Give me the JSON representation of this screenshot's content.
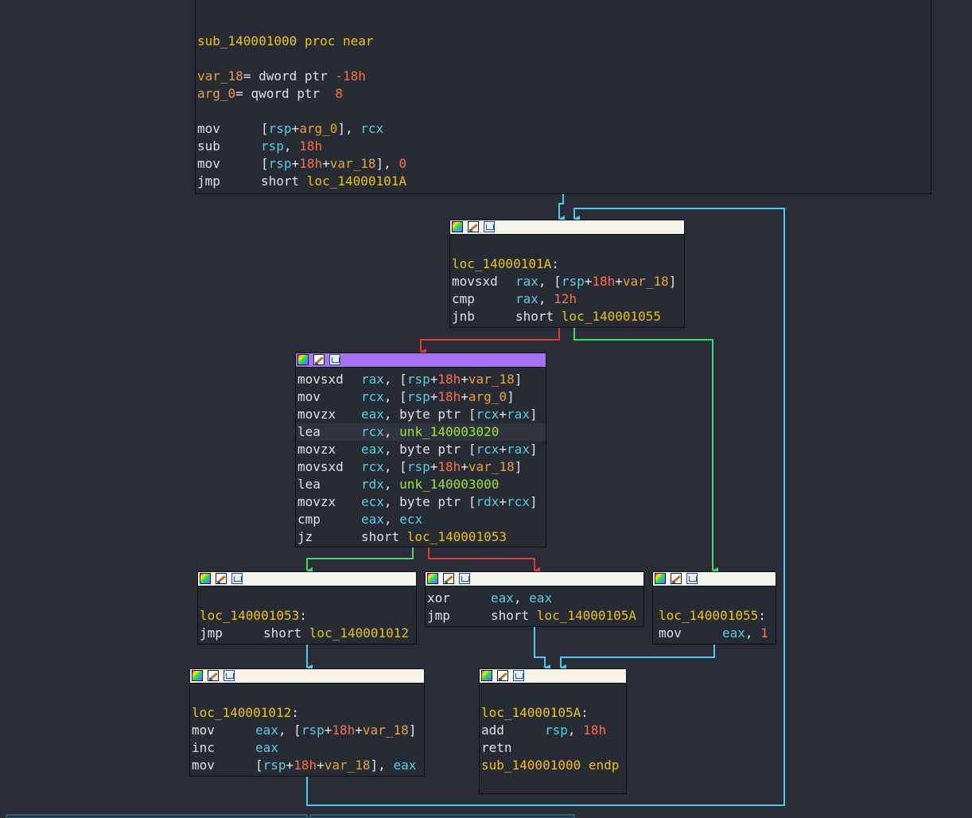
{
  "blocks": {
    "entry": {
      "proc_decl": "sub_140001000 proc near",
      "var_18": {
        "name": "var_18",
        "eq": "= dword ptr ",
        "val": "-18h"
      },
      "arg_0": {
        "name": "arg_0",
        "eq": "= qword ptr  ",
        "val": "8"
      },
      "instructions": [
        {
          "mnemonic": "mov",
          "ops": [
            {
              "t": "p",
              "v": "["
            },
            {
              "t": "r",
              "v": "rsp"
            },
            {
              "t": "p",
              "v": "+"
            },
            {
              "t": "v",
              "v": "arg_0"
            },
            {
              "t": "p",
              "v": "], "
            },
            {
              "t": "r",
              "v": "rcx"
            }
          ]
        },
        {
          "mnemonic": "sub",
          "ops": [
            {
              "t": "r",
              "v": "rsp"
            },
            {
              "t": "p",
              "v": ", "
            },
            {
              "t": "n",
              "v": "18h"
            }
          ]
        },
        {
          "mnemonic": "mov",
          "ops": [
            {
              "t": "p",
              "v": "["
            },
            {
              "t": "r",
              "v": "rsp"
            },
            {
              "t": "p",
              "v": "+"
            },
            {
              "t": "n",
              "v": "18h"
            },
            {
              "t": "p",
              "v": "+"
            },
            {
              "t": "v",
              "v": "var_18"
            },
            {
              "t": "p",
              "v": "], "
            },
            {
              "t": "n",
              "v": "0"
            }
          ]
        },
        {
          "mnemonic": "jmp",
          "ops": [
            {
              "t": "w",
              "v": "short "
            },
            {
              "t": "loc",
              "v": "loc_14000101A"
            }
          ]
        }
      ]
    },
    "loop_head": {
      "label": "loc_14000101A",
      "instructions": [
        {
          "mnemonic": "movsxd",
          "ops": [
            {
              "t": "r",
              "v": "rax"
            },
            {
              "t": "p",
              "v": ", ["
            },
            {
              "t": "r",
              "v": "rsp"
            },
            {
              "t": "p",
              "v": "+"
            },
            {
              "t": "n",
              "v": "18h"
            },
            {
              "t": "p",
              "v": "+"
            },
            {
              "t": "v",
              "v": "var_18"
            },
            {
              "t": "p",
              "v": "]"
            }
          ]
        },
        {
          "mnemonic": "cmp",
          "ops": [
            {
              "t": "r",
              "v": "rax"
            },
            {
              "t": "p",
              "v": ", "
            },
            {
              "t": "n",
              "v": "12h"
            }
          ]
        },
        {
          "mnemonic": "jnb",
          "ops": [
            {
              "t": "w",
              "v": "short "
            },
            {
              "t": "loc",
              "v": "loc_140001055"
            }
          ]
        }
      ]
    },
    "compare": {
      "instructions": [
        {
          "mnemonic": "movsxd",
          "ops": [
            {
              "t": "r",
              "v": "rax"
            },
            {
              "t": "p",
              "v": ", ["
            },
            {
              "t": "r",
              "v": "rsp"
            },
            {
              "t": "p",
              "v": "+"
            },
            {
              "t": "n",
              "v": "18h"
            },
            {
              "t": "p",
              "v": "+"
            },
            {
              "t": "v",
              "v": "var_18"
            },
            {
              "t": "p",
              "v": "]"
            }
          ]
        },
        {
          "mnemonic": "mov",
          "ops": [
            {
              "t": "r",
              "v": "rcx"
            },
            {
              "t": "p",
              "v": ", ["
            },
            {
              "t": "r",
              "v": "rsp"
            },
            {
              "t": "p",
              "v": "+"
            },
            {
              "t": "n",
              "v": "18h"
            },
            {
              "t": "p",
              "v": "+"
            },
            {
              "t": "v",
              "v": "arg_0"
            },
            {
              "t": "p",
              "v": "]"
            }
          ]
        },
        {
          "mnemonic": "movzx",
          "ops": [
            {
              "t": "r",
              "v": "eax"
            },
            {
              "t": "p",
              "v": ", byte ptr ["
            },
            {
              "t": "r",
              "v": "rcx"
            },
            {
              "t": "p",
              "v": "+"
            },
            {
              "t": "r",
              "v": "rax"
            },
            {
              "t": "p",
              "v": "]"
            }
          ]
        },
        {
          "mnemonic": "lea",
          "ops": [
            {
              "t": "r",
              "v": "rcx"
            },
            {
              "t": "p",
              "v": ", "
            },
            {
              "t": "unk",
              "v": "unk_140003020"
            }
          ],
          "highlight": true
        },
        {
          "mnemonic": "movzx",
          "ops": [
            {
              "t": "r",
              "v": "eax"
            },
            {
              "t": "p",
              "v": ", byte ptr ["
            },
            {
              "t": "r",
              "v": "rcx"
            },
            {
              "t": "p",
              "v": "+"
            },
            {
              "t": "r",
              "v": "rax"
            },
            {
              "t": "p",
              "v": "]"
            }
          ]
        },
        {
          "mnemonic": "movsxd",
          "ops": [
            {
              "t": "r",
              "v": "rcx"
            },
            {
              "t": "p",
              "v": ", ["
            },
            {
              "t": "r",
              "v": "rsp"
            },
            {
              "t": "p",
              "v": "+"
            },
            {
              "t": "n",
              "v": "18h"
            },
            {
              "t": "p",
              "v": "+"
            },
            {
              "t": "v",
              "v": "var_18"
            },
            {
              "t": "p",
              "v": "]"
            }
          ]
        },
        {
          "mnemonic": "lea",
          "ops": [
            {
              "t": "r",
              "v": "rdx"
            },
            {
              "t": "p",
              "v": ", "
            },
            {
              "t": "unk",
              "v": "unk_140003000"
            }
          ]
        },
        {
          "mnemonic": "movzx",
          "ops": [
            {
              "t": "r",
              "v": "ecx"
            },
            {
              "t": "p",
              "v": ", byte ptr ["
            },
            {
              "t": "r",
              "v": "rdx"
            },
            {
              "t": "p",
              "v": "+"
            },
            {
              "t": "r",
              "v": "rcx"
            },
            {
              "t": "p",
              "v": "]"
            }
          ]
        },
        {
          "mnemonic": "cmp",
          "ops": [
            {
              "t": "r",
              "v": "eax"
            },
            {
              "t": "p",
              "v": ", "
            },
            {
              "t": "r",
              "v": "ecx"
            }
          ]
        },
        {
          "mnemonic": "jz",
          "ops": [
            {
              "t": "w",
              "v": "short "
            },
            {
              "t": "loc",
              "v": "loc_140001053"
            }
          ]
        }
      ]
    },
    "match": {
      "label": "loc_140001053",
      "instructions": [
        {
          "mnemonic": "jmp",
          "ops": [
            {
              "t": "w",
              "v": "short "
            },
            {
              "t": "loc",
              "v": "loc_140001012"
            }
          ]
        }
      ]
    },
    "mismatch": {
      "instructions": [
        {
          "mnemonic": "xor",
          "ops": [
            {
              "t": "r",
              "v": "eax"
            },
            {
              "t": "p",
              "v": ", "
            },
            {
              "t": "r",
              "v": "eax"
            }
          ]
        },
        {
          "mnemonic": "jmp",
          "ops": [
            {
              "t": "w",
              "v": "short "
            },
            {
              "t": "loc",
              "v": "loc_14000105A"
            }
          ]
        }
      ]
    },
    "success": {
      "label": "loc_140001055",
      "instructions": [
        {
          "mnemonic": "mov",
          "ops": [
            {
              "t": "r",
              "v": "eax"
            },
            {
              "t": "p",
              "v": ", "
            },
            {
              "t": "n",
              "v": "1"
            }
          ]
        }
      ]
    },
    "increment": {
      "label": "loc_140001012",
      "instructions": [
        {
          "mnemonic": "mov",
          "ops": [
            {
              "t": "r",
              "v": "eax"
            },
            {
              "t": "p",
              "v": ", ["
            },
            {
              "t": "r",
              "v": "rsp"
            },
            {
              "t": "p",
              "v": "+"
            },
            {
              "t": "n",
              "v": "18h"
            },
            {
              "t": "p",
              "v": "+"
            },
            {
              "t": "v",
              "v": "var_18"
            },
            {
              "t": "p",
              "v": "]"
            }
          ]
        },
        {
          "mnemonic": "inc",
          "ops": [
            {
              "t": "r",
              "v": "eax"
            }
          ]
        },
        {
          "mnemonic": "mov",
          "ops": [
            {
              "t": "p",
              "v": "["
            },
            {
              "t": "r",
              "v": "rsp"
            },
            {
              "t": "p",
              "v": "+"
            },
            {
              "t": "n",
              "v": "18h"
            },
            {
              "t": "p",
              "v": "+"
            },
            {
              "t": "v",
              "v": "var_18"
            },
            {
              "t": "p",
              "v": "], "
            },
            {
              "t": "r",
              "v": "eax"
            }
          ]
        }
      ]
    },
    "exit": {
      "label": "loc_14000105A",
      "instructions": [
        {
          "mnemonic": "add",
          "ops": [
            {
              "t": "r",
              "v": "rsp"
            },
            {
              "t": "p",
              "v": ", "
            },
            {
              "t": "n",
              "v": "18h"
            }
          ]
        },
        {
          "mnemonic": "retn",
          "ops": []
        }
      ],
      "endp": "sub_140001000 endp"
    }
  },
  "colors": {
    "background": "#2a2d38",
    "block_bg": "#272b34",
    "header": "#f4f4ea",
    "selected_header": "#a573f0",
    "edge_flow": "#4ec9f0",
    "edge_true": "#3bdc6a",
    "edge_false": "#e03a3a"
  }
}
